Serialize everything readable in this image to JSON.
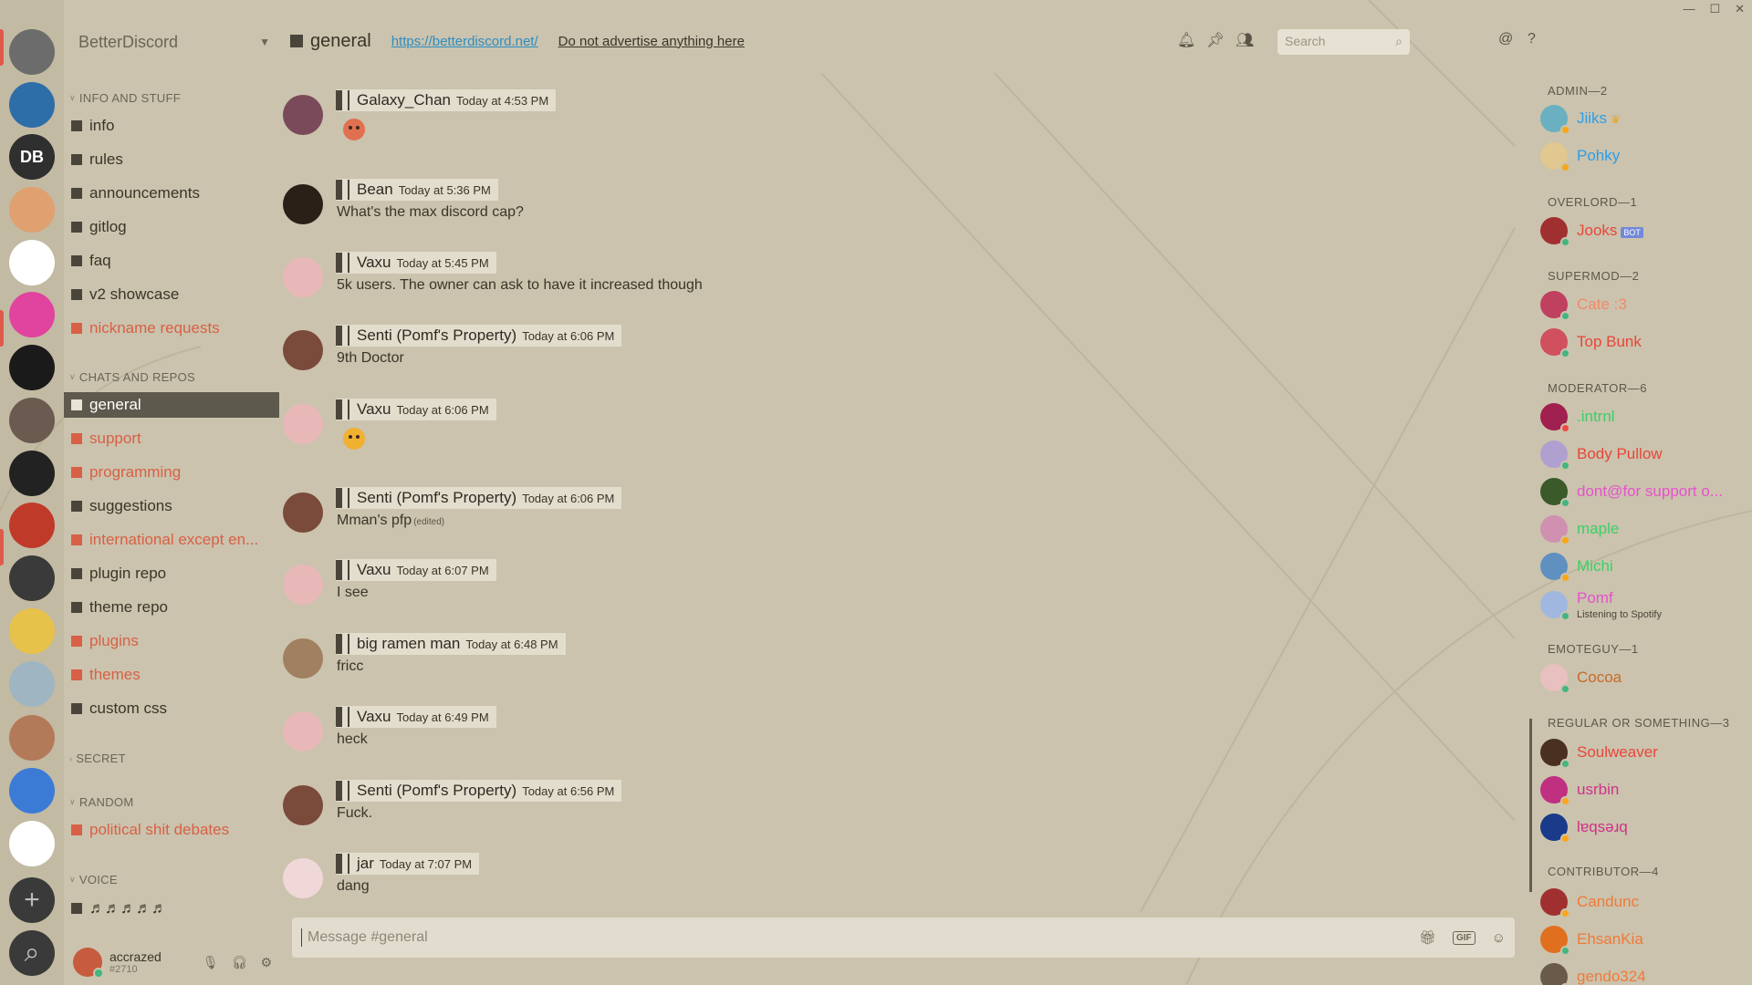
{
  "window": {
    "minimize": "—",
    "maximize": "☐",
    "close": "✕"
  },
  "guild": {
    "name": "BetterDiscord"
  },
  "servers": {
    "items": [
      {
        "label": "",
        "color": "#6c6c6c"
      },
      {
        "label": "",
        "color": "#2d6ea8"
      },
      {
        "label": "DB",
        "color": "#2f2f2f"
      },
      {
        "label": "",
        "color": "#e0a070"
      },
      {
        "label": "",
        "color": "#ffffff"
      },
      {
        "label": "",
        "color": "#e0449e"
      },
      {
        "label": "",
        "color": "#1a1a1a"
      },
      {
        "label": "",
        "color": "#6a5a50"
      },
      {
        "label": "",
        "color": "#222222"
      },
      {
        "label": "",
        "color": "#c03a2a"
      },
      {
        "label": "",
        "color": "#3a3a3a"
      },
      {
        "label": "",
        "color": "#e6c24a"
      },
      {
        "label": "",
        "color": "#9fb6c2"
      },
      {
        "label": "",
        "color": "#b37a5a"
      },
      {
        "label": "",
        "color": "#3b7bd6"
      },
      {
        "label": "",
        "color": "#ffffff"
      }
    ],
    "add_label": "+",
    "search_label": "⌕"
  },
  "categories": {
    "info": "INFO AND STUFF",
    "chats": "CHATS AND REPOS",
    "secret": "SECRET",
    "random": "RANDOM",
    "voice": "VOICE"
  },
  "channels": {
    "info": "info",
    "rules": "rules",
    "announcements": "announcements",
    "gitlog": "gitlog",
    "faq": "faq",
    "v2showcase": "v2 showcase",
    "nickname": "nickname requests",
    "general": "general",
    "support": "support",
    "programming": "programming",
    "suggestions": "suggestions",
    "international": "international except en...",
    "plugin_repo": "plugin repo",
    "theme_repo": "theme repo",
    "plugins": "plugins",
    "themes": "themes",
    "custom_css": "custom css",
    "political": "political shit debates",
    "voice": "♬♬♬♬♬"
  },
  "user": {
    "name": "accrazed",
    "tag": "#2710"
  },
  "header": {
    "channel": "general",
    "topic_link": "https://betterdiscord.net/",
    "topic_rules": "Do not advertise anything here",
    "search_placeholder": "Search"
  },
  "messages": [
    {
      "author": "Galaxy_Chan",
      "time": "Today at 4:53 PM",
      "text": "",
      "avatar": "#7a4a5a",
      "emoji": true
    },
    {
      "author": "Bean",
      "time": "Today at 5:36 PM",
      "text": "What's the max discord cap?",
      "avatar": "#2a2018"
    },
    {
      "author": "Vaxu",
      "time": "Today at 5:45 PM",
      "text": "5k users. The owner can ask to have it increased though",
      "avatar": "#e8b8b8"
    },
    {
      "author": "Senti (Pomf's Property)",
      "time": "Today at 6:06 PM",
      "text": "9th Doctor",
      "avatar": "#7a4a3a"
    },
    {
      "author": "Vaxu",
      "time": "Today at 6:06 PM",
      "text": "",
      "avatar": "#e8b8b8",
      "emoji": true
    },
    {
      "author": "Senti (Pomf's Property)",
      "time": "Today at 6:06 PM",
      "text": "Mman's pfp",
      "edited": "(edited)",
      "avatar": "#7a4a3a"
    },
    {
      "author": "Vaxu",
      "time": "Today at 6:07 PM",
      "text": "I see",
      "avatar": "#e8b8b8"
    },
    {
      "author": "big ramen man",
      "time": "Today at 6:48 PM",
      "text": "fricc",
      "avatar": "#a08060"
    },
    {
      "author": "Vaxu",
      "time": "Today at 6:49 PM",
      "text": "heck",
      "avatar": "#e8b8b8"
    },
    {
      "author": "Senti (Pomf's Property)",
      "time": "Today at 6:56 PM",
      "text": "Fuck.",
      "avatar": "#7a4a3a"
    },
    {
      "author": "jar",
      "time": "Today at 7:07 PM",
      "text": "dang",
      "avatar": "#f0d8d8"
    }
  ],
  "composer": {
    "placeholder": "Message #general"
  },
  "members": {
    "roles": [
      "ADMIN—2",
      "OVERLORD—1",
      "SUPERMOD—2",
      "MODERATOR—6",
      "EMOTEGUY—1",
      "REGULAR OR SOMETHING—3",
      "CONTRIBUTOR—4"
    ],
    "list": [
      {
        "name": "Jiiks",
        "color": "#2b9ee8",
        "status": "idle",
        "avatar": "#6ab0c0"
      },
      {
        "name": "Pohky",
        "color": "#2b9ee8",
        "status": "idle",
        "avatar": "#e0c890"
      },
      {
        "name": "Jooks",
        "color": "#e8463a",
        "status": "online",
        "avatar": "#a03030",
        "bot": "BOT"
      },
      {
        "name": "Cate :3",
        "color": "#f08a6a",
        "status": "online",
        "avatar": "#c04060"
      },
      {
        "name": "Top Bunk",
        "color": "#e8463a",
        "status": "online",
        "avatar": "#d05060"
      },
      {
        "name": ".intrnl",
        "color": "#3ad068",
        "status": "dnd",
        "avatar": "#a02050"
      },
      {
        "name": "Body Pullow",
        "color": "#e8463a",
        "status": "online",
        "avatar": "#b0a0d0"
      },
      {
        "name": "dont@for support o...",
        "color": "#e850d0",
        "status": "online",
        "avatar": "#3a5a2a"
      },
      {
        "name": "maple",
        "color": "#3ad068",
        "status": "idle",
        "avatar": "#d090b0"
      },
      {
        "name": "Michi",
        "color": "#3ad068",
        "status": "idle",
        "avatar": "#6090c0"
      },
      {
        "name": "Pomf",
        "color": "#e850d0",
        "status": "online",
        "avatar": "#a0b8e0",
        "sub": "Listening to Spotify"
      },
      {
        "name": "Cocoa",
        "color": "#c86a2a",
        "status": "online",
        "avatar": "#e8c0c0"
      },
      {
        "name": "Soulweaver",
        "color": "#e8463a",
        "status": "online",
        "avatar": "#4a3020"
      },
      {
        "name": "usrbin",
        "color": "#d0308a",
        "status": "idle",
        "avatar": "#c03080"
      },
      {
        "name": "lɐqsǝɹq",
        "color": "#d0308a",
        "status": "idle",
        "avatar": "#1a3a8a"
      },
      {
        "name": "Candunc",
        "color": "#f07a3a",
        "status": "idle",
        "avatar": "#a03030"
      },
      {
        "name": "EhsanKia",
        "color": "#f07a3a",
        "status": "online",
        "avatar": "#e07020"
      },
      {
        "name": "gendo324",
        "color": "#f07a3a",
        "status": "online",
        "avatar": "#6a5a4a"
      }
    ]
  }
}
